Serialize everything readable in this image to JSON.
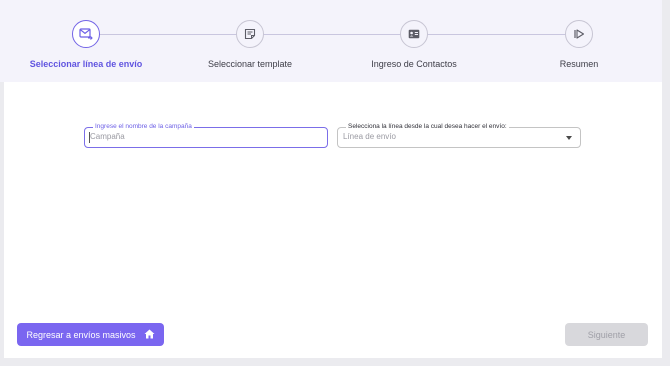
{
  "stepper": {
    "steps": [
      {
        "label": "Seleccionar línea de envío",
        "icon": "mail-send-icon",
        "active": true
      },
      {
        "label": "Seleccionar template",
        "icon": "template-icon",
        "active": false
      },
      {
        "label": "Ingreso de Contactos",
        "icon": "contacts-card-icon",
        "active": false
      },
      {
        "label": "Resumen",
        "icon": "summary-play-icon",
        "active": false
      }
    ]
  },
  "form": {
    "campaign": {
      "label": "Ingrese el nombre de la campaña",
      "placeholder": "Campaña"
    },
    "line": {
      "label": "Selecciona la línea desde la cual desea hacer el envío:",
      "placeholder": "Línea de envío"
    }
  },
  "footer": {
    "back_label": "Regresar a envíos masivos",
    "back_icon": "home-icon",
    "next_label": "Siguiente"
  },
  "colors": {
    "accent": "#7a66f0",
    "disabled": "#d8d8dc"
  }
}
